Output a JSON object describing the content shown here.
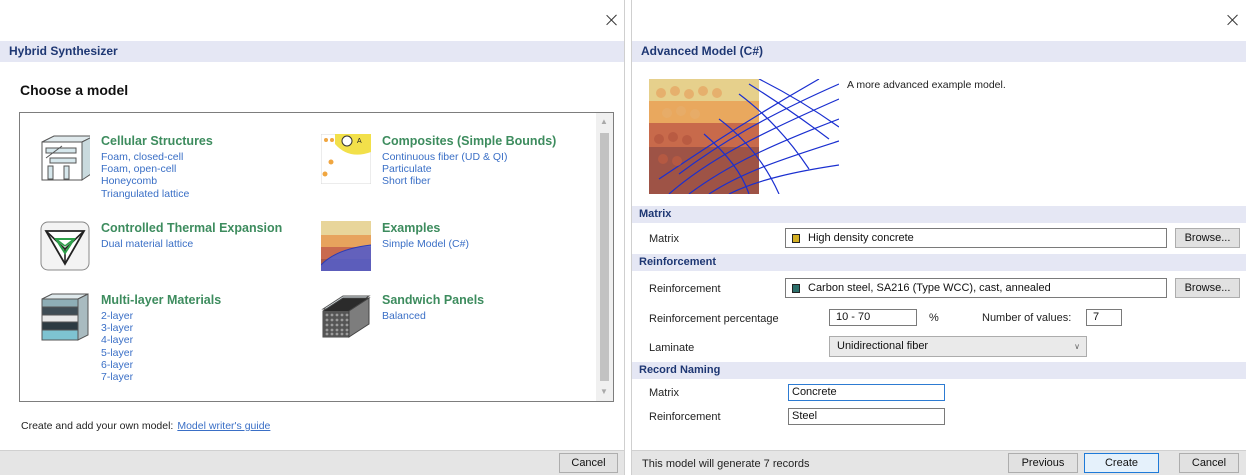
{
  "left": {
    "title": "Hybrid Synthesizer",
    "heading": "Choose a model",
    "categories": [
      {
        "title": "Cellular Structures",
        "items": [
          "Foam, closed-cell",
          "Foam, open-cell",
          "Honeycomb",
          "Triangulated lattice"
        ]
      },
      {
        "title": "Composites (Simple Bounds)",
        "items": [
          "Continuous fiber (UD & QI)",
          "Particulate",
          "Short fiber"
        ]
      },
      {
        "title": "Controlled Thermal Expansion",
        "items": [
          "Dual material lattice"
        ]
      },
      {
        "title": "Examples",
        "items": [
          "Simple Model (C#)"
        ]
      },
      {
        "title": "Multi-layer Materials",
        "items": [
          "2-layer",
          "3-layer",
          "4-layer",
          "5-layer",
          "6-layer",
          "7-layer"
        ]
      },
      {
        "title": "Sandwich Panels",
        "items": [
          "Balanced"
        ]
      }
    ],
    "footer_text": "Create and add your own model:",
    "footer_link": "Model writer's guide",
    "cancel": "Cancel",
    "composite_icon_label": "A"
  },
  "right": {
    "title": "Advanced Model (C#)",
    "description": "A more advanced example model.",
    "matrix_section": "Matrix",
    "matrix_label": "Matrix",
    "matrix_value": "High density concrete",
    "matrix_color": "#d4b024",
    "browse": "Browse...",
    "reinforcement_section": "Reinforcement",
    "reinforcement_label": "Reinforcement",
    "reinforcement_value": "Carbon steel, SA216 (Type WCC), cast, annealed",
    "reinforcement_color": "#2c6f6b",
    "percentage_label": "Reinforcement percentage",
    "percentage_value": "10 - 70",
    "percent_unit": "%",
    "num_values_label": "Number of values:",
    "num_values": "7",
    "laminate_label": "Laminate",
    "laminate_value": "Unidirectional fiber",
    "naming_section": "Record Naming",
    "naming_matrix_label": "Matrix",
    "naming_matrix_value": "Concrete",
    "naming_reinf_label": "Reinforcement",
    "naming_reinf_value": "Steel",
    "status": "This model will generate 7 records",
    "previous": "Previous",
    "create": "Create",
    "cancel": "Cancel"
  }
}
